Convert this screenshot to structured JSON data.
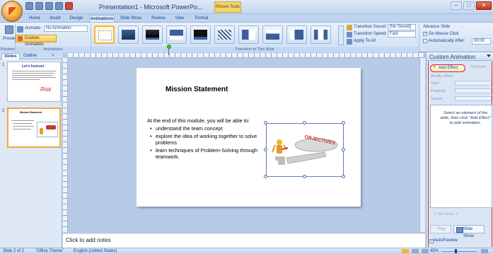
{
  "window": {
    "title": "Presentation1 - Microsoft PowerPo...",
    "context_tab": "Picture Tools",
    "min": "–",
    "max": "□",
    "close": "✕"
  },
  "ribbon": {
    "tabs": [
      "Home",
      "Insert",
      "Design",
      "Animations",
      "Slide Show",
      "Review",
      "View",
      "Format"
    ],
    "active_tab": "Animations",
    "preview_label": "Preview",
    "animate_label": "Animate:",
    "animate_value": "No Animation",
    "custom_animation_label": "Custom Animation",
    "groups": {
      "preview": "Preview",
      "animations": "Animations",
      "transition": "Transition to This Slide"
    },
    "transition_sound_label": "Transition Sound:",
    "transition_sound_value": "[No Sound]",
    "transition_speed_label": "Transition Speed:",
    "transition_speed_value": "Fast",
    "apply_to_all_label": "Apply To All",
    "advance_slide_label": "Advance Slide",
    "on_mouse_click_label": "On Mouse Click",
    "auto_after_label": "Automatically After:",
    "auto_after_value": "00:00"
  },
  "left_panel": {
    "tabs": [
      "Slides",
      "Outline"
    ],
    "close": "×",
    "slides": [
      {
        "number": "1",
        "title": "Let's Instruct",
        "word": "Risk"
      },
      {
        "number": "2",
        "title": "Mission Statement"
      }
    ]
  },
  "slide": {
    "title": "Mission Statement",
    "intro": "At the end of this module, you will be able to:",
    "bullets": [
      "understand the team concept",
      "explore the idea of working together to solve problems",
      "learn techniques of Problem-Solving through teamwork."
    ],
    "picture_caption": "OBJECTIVES"
  },
  "notes_placeholder": "Click to add notes",
  "task_pane": {
    "title": "Custom Animation",
    "add_effect": "Add Effect",
    "remove": "Remove",
    "modify_label": "Modify effect",
    "fields": [
      "Start:",
      "Property:",
      "Speed:"
    ],
    "hint": "Select an element of the slide, then click \"Add Effect\" to add animation.",
    "reorder_label": "Re-Order",
    "play_label": "Play",
    "slideshow_label": "Slide Show",
    "autopreview_label": "AutoPreview"
  },
  "status": {
    "slide_info": "Slide 2 of 2",
    "theme": "\"Office Theme\"",
    "language": "English (United States)",
    "zoom": "45%"
  },
  "colors": {
    "ribbon_bg": "#dbe6f5",
    "accent_red": "#d2231c",
    "highlight_gold": "#f6c94f"
  }
}
